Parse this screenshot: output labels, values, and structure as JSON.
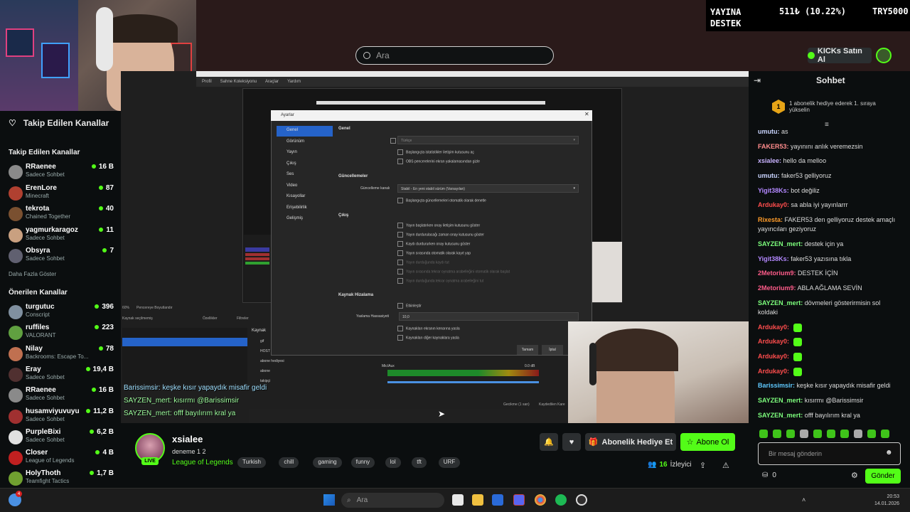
{
  "top": {
    "search_placeholder": "Ara",
    "ticker_left": "YAYINA\nDESTEK",
    "ticker_line1": "YAYINA",
    "ticker_line2": "DESTEK",
    "ticker_amount": "511₺ (10.22%)",
    "ticker_goal": "TRY5000",
    "kicks_label": "KICKs Satın Al"
  },
  "sidebar": {
    "followed_header": "Takip Edilen Kanallar",
    "followed_title": "Takip Edilen Kanallar",
    "followed": [
      {
        "name": "RRaenee",
        "sub": "Sadece Sohbet",
        "count": "16 B",
        "color": "#8a8a8a"
      },
      {
        "name": "ErenLore",
        "sub": "Minecraft",
        "count": "87",
        "color": "#b04030"
      },
      {
        "name": "tekrota",
        "sub": "Chained Together",
        "count": "40",
        "color": "#7a5030"
      },
      {
        "name": "yagmurkaragoz",
        "sub": "Sadece Sohbet",
        "count": "11",
        "color": "#c9a080"
      },
      {
        "name": "Obsyra",
        "sub": "Sadece Sohbet",
        "count": "7",
        "color": "#606070"
      }
    ],
    "show_more": "Daha Fazla Göster",
    "suggested_title": "Önerilen Kanallar",
    "suggested": [
      {
        "name": "turgutuc",
        "sub": "Conscript",
        "count": "396",
        "color": "#8090a0"
      },
      {
        "name": "ruffiles",
        "sub": "VALORANT",
        "count": "223",
        "color": "#60a040"
      },
      {
        "name": "Nilay",
        "sub": "Backrooms: Escape To...",
        "count": "78",
        "color": "#c07050"
      },
      {
        "name": "Eray",
        "sub": "Sadece Sohbet",
        "count": "19,4 B",
        "color": "#503030"
      },
      {
        "name": "RRaenee",
        "sub": "Sadece Sohbet",
        "count": "16 B",
        "color": "#8a8a8a"
      },
      {
        "name": "husamviyuvuyu",
        "sub": "Sadece Sohbet",
        "count": "11,2 B",
        "color": "#a03030"
      },
      {
        "name": "PurpleBixi",
        "sub": "Sadece Sohbet",
        "count": "6,2 B",
        "color": "#e0e0e0"
      },
      {
        "name": "Closer",
        "sub": "League of Legends",
        "count": "4 B",
        "color": "#c02020"
      },
      {
        "name": "HolyThoth",
        "sub": "Teamfight Tactics",
        "count": "1,7 B",
        "color": "#70a030"
      }
    ]
  },
  "obs": {
    "menu": [
      "Profil",
      "Sahne Koleksiyonu",
      "Araçlar",
      "Yardım"
    ],
    "settings_title": "Ayarlar",
    "nav": [
      "Genel",
      "Görünüm",
      "Yayın",
      "Çıkış",
      "Ses",
      "Video",
      "Kısayollar",
      "Erişebilirlik",
      "Gelişmiş"
    ],
    "section_general": "Genel",
    "lang_label": "Dil",
    "lang_value": "Türkçe",
    "cb1": "Başlangıçta istatistikler iletişim kutusunu aç",
    "cb2": "OBS pencerelerini ekran yakalamasından gizle",
    "section_updates": "Güncellemeler",
    "update_label": "Güncelleme kanalı",
    "update_value": "Stabil - En yeni stabil sürüm (Varsayılan)",
    "cb3": "Başlangıçta güncellemeleri otomatik olarak denetle",
    "section_output": "Çıkış",
    "out1": "Yayın başlatırken onay iletişim kutusunu göster",
    "out2": "Yayın durdurulacağı zaman onay kutusunu göster",
    "out3": "Kaydı durdururken onay kutusunu göster",
    "out4": "Yayın sırasında otomatik olarak kayıt yap",
    "out5": "Yayın durduğunda kaydı tut",
    "out6": "Yayın sırasında tekrar oynatma arabelleğini otomatik olarak başlat",
    "out7": "Yayın durduğunda tekrar oynatma arabelleğini tut",
    "section_snap": "Kaynak Hizalama",
    "snap1": "Etkinleştir",
    "snap_label": "Yaslama Hassasiyeti",
    "snap_value": "10,0",
    "snap2": "Kaynakları ekranın kenarına yasla",
    "snap3": "Kaynakları diğer kaynaklara yasla",
    "ok": "Tamam",
    "cancel": "İptal",
    "src_none": "Kaynak seçilmemiş",
    "props": "Özellikler",
    "filters": "Filtreler",
    "sources_header": "Kaynak",
    "sources": [
      "gif",
      "HOST",
      "abone hediyesi",
      "abone",
      "takipçi"
    ],
    "mixer_label": "Mic/Aux",
    "mixer_db": "0.0 dB",
    "delay": "Gecikme (1 san)",
    "record": "Kaydedilen Kare",
    "zoom": "60%",
    "canvas_size": "Pencereye Boyutlandır",
    "stream_chat1": "Barissimsir: keşke kısır yapaydık misafir geldi",
    "stream_chat2": "SAYZEN_mert: kısırmı @Barissimsir",
    "stream_chat3": "SAYZEN_mert: offf bayılırım kral ya"
  },
  "chat": {
    "title": "Sohbet",
    "pinned": "1 abonelik hediye ederek 1. sıraya yükselin",
    "pinned_rank": "1",
    "messages": [
      {
        "user": "umutu",
        "text": " as",
        "color": "#c9d4ff"
      },
      {
        "user": "FAKER53",
        "text": " yayınını anlık veremezsin",
        "color": "#ff8c8c"
      },
      {
        "user": "xsialee",
        "text": " hello da melloo",
        "color": "#c9b3ff"
      },
      {
        "user": "umutu",
        "text": " faker53 gelliyoruz",
        "color": "#c9d4ff"
      },
      {
        "user": "Yigit38Ks",
        "text": " bot değiliz",
        "color": "#b388ff"
      },
      {
        "user": "Ardukay0",
        "text": " sa abla iyi yayınlarrr",
        "color": "#ff4d4d"
      },
      {
        "user": "Rixesta",
        "text": " FAKER53 den gelliyoruz destek amaçlı yayıncıları geziyoruz",
        "color": "#ff9c2a"
      },
      {
        "user": "SAYZEN_mert",
        "text": " destek için ya",
        "color": "#7dff7d"
      },
      {
        "user": "Yigit38Ks",
        "text": " faker53 yazısına tıkla",
        "color": "#b388ff"
      },
      {
        "user": "2Metorium9",
        "text": " DESTEK İÇİN",
        "color": "#ff5c8a"
      },
      {
        "user": "2Metorium9",
        "text": " ABLA AĞLAMA SEVİN",
        "color": "#ff5c8a"
      },
      {
        "user": "SAYZEN_mert",
        "text": " dövmeleri gösterirmisin sol koldaki",
        "color": "#7dff7d"
      },
      {
        "user": "Ardukay0",
        "text": "",
        "color": "#ff4d4d"
      },
      {
        "user": "Ardukay0",
        "text": "",
        "color": "#ff4d4d"
      },
      {
        "user": "Ardukay0",
        "text": "",
        "color": "#ff4d4d"
      },
      {
        "user": "Ardukay0",
        "text": "",
        "color": "#ff4d4d"
      },
      {
        "user": "Barissimsir",
        "text": " keşke kısır yapaydık misafir geldi",
        "color": "#5fc9ff"
      },
      {
        "user": "SAYZEN_mert",
        "text": " kısırmı @Barissimsir",
        "color": "#7dff7d"
      },
      {
        "user": "SAYZEN_mert",
        "text": " offf bayılırım kral ya",
        "color": "#7dff7d"
      }
    ],
    "input_placeholder": "Bir mesaj gönderin",
    "points": "0",
    "send": "Gönder"
  },
  "stream": {
    "streamer": "xsialee",
    "title": "deneme 1 2",
    "category": "League of Legends",
    "live": "LIVE",
    "tags": [
      "Turkish",
      "chill",
      "gaming",
      "funny",
      "lol",
      "tft",
      "URF"
    ],
    "viewers": "16",
    "viewers_label": "İzleyici",
    "gift_sub": "Abonelik Hediye Et",
    "subscribe": "Abone Ol"
  },
  "taskbar": {
    "search_placeholder": "Ara",
    "clock_time": "20:53",
    "clock_date": "14.01.2026",
    "notif_count": "4"
  },
  "colors": {
    "accent": "#53fc18",
    "bg": "#0b0e0f"
  }
}
